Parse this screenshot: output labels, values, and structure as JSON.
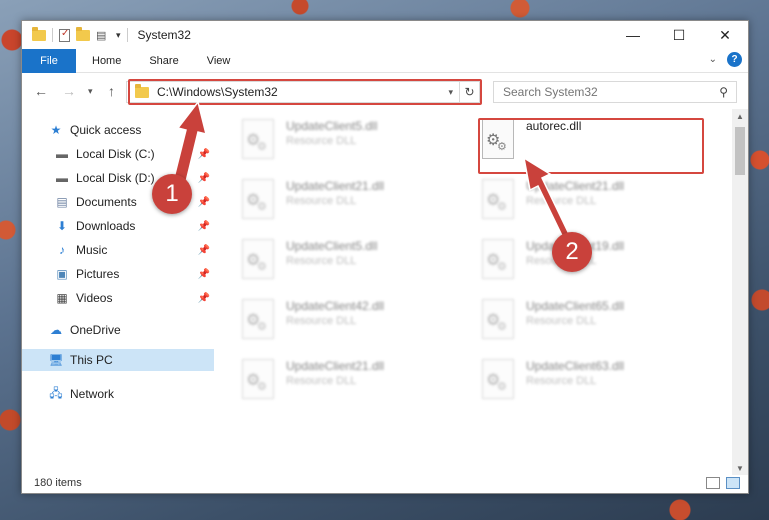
{
  "window": {
    "title": "System32",
    "controls": {
      "minimize": "—",
      "maximize": "☐",
      "close": "✕"
    }
  },
  "ribbon": {
    "tabs": [
      "File",
      "Home",
      "Share",
      "View"
    ]
  },
  "address": {
    "path": "C:\\Windows\\System32"
  },
  "search": {
    "placeholder": "Search System32"
  },
  "navpane": {
    "items": [
      {
        "label": "Quick access",
        "icon": "star-icon"
      },
      {
        "label": "Local Disk (C:)",
        "icon": "drive-icon"
      },
      {
        "label": "Local Disk (D:)",
        "icon": "drive-icon"
      },
      {
        "label": "Documents",
        "icon": "documents-icon"
      },
      {
        "label": "Downloads",
        "icon": "download-icon"
      },
      {
        "label": "Music",
        "icon": "music-icon"
      },
      {
        "label": "Pictures",
        "icon": "pictures-icon"
      },
      {
        "label": "Videos",
        "icon": "videos-icon"
      },
      {
        "label": "OneDrive",
        "icon": "cloud-icon"
      },
      {
        "label": "This PC",
        "icon": "computer-icon"
      },
      {
        "label": "Network",
        "icon": "network-icon"
      }
    ]
  },
  "files": [
    {
      "name": "UpdateClient5.dll",
      "type": "Resource DLL"
    },
    {
      "name": "autorec.dll",
      "type": ""
    },
    {
      "name": "UpdateClient21.dll",
      "type": "Resource DLL"
    },
    {
      "name": "UpdateClient21.dll",
      "type": "Resource DLL"
    },
    {
      "name": "UpdateClient5.dll",
      "type": "Resource DLL"
    },
    {
      "name": "UpdateClient19.dll",
      "type": "Resource DLL"
    },
    {
      "name": "UpdateClient42.dll",
      "type": "Resource DLL"
    },
    {
      "name": "UpdateClient65.dll",
      "type": "Resource DLL"
    },
    {
      "name": "UpdateClient21.dll",
      "type": "Resource DLL"
    },
    {
      "name": "UpdateClient63.dll",
      "type": "Resource DLL"
    }
  ],
  "status": {
    "item_count": "180 items"
  },
  "annotations": {
    "step1": "1",
    "step2": "2",
    "color": "#c9413b"
  }
}
